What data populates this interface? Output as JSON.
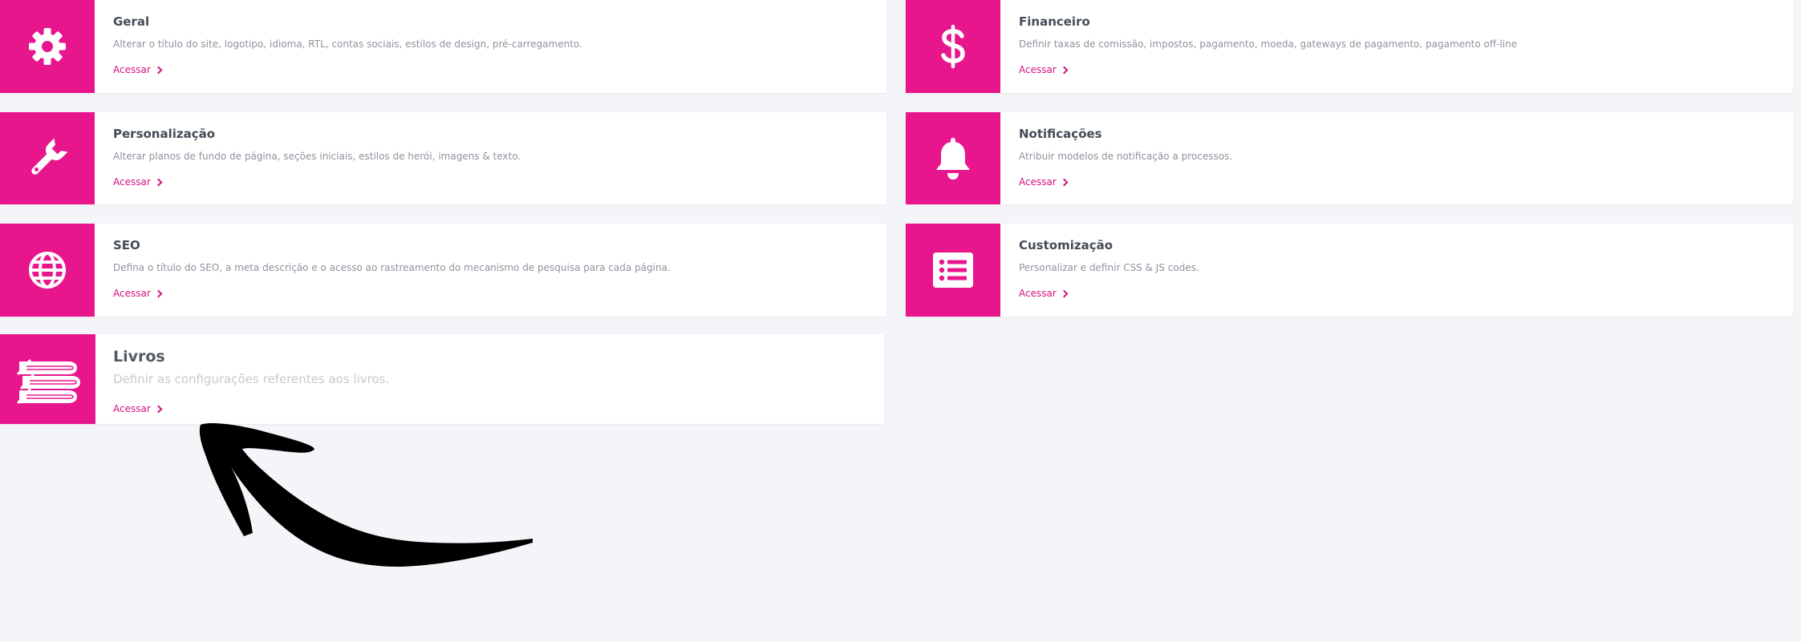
{
  "theme": {
    "accent": "#e8168c",
    "link": "#d4127f",
    "background": "#f4f5f9"
  },
  "cards": [
    {
      "title": "Geral",
      "description": "Alterar o título do site, logotipo, idioma, RTL, contas sociais, estilos de design, pré-carregamento.",
      "link": "Acessar",
      "icon": "gear-icon"
    },
    {
      "title": "Financeiro",
      "description": "Definir taxas de comissão, impostos, pagamento, moeda, gateways de pagamento, pagamento off-line",
      "link": "Acessar",
      "icon": "dollar-icon"
    },
    {
      "title": "Personalização",
      "description": "Alterar planos de fundo de página, seções iniciais, estilos de herói, imagens & texto.",
      "link": "Acessar",
      "icon": "wrench-icon"
    },
    {
      "title": "Notificações",
      "description": "Atribuir modelos de notificação a processos.",
      "link": "Acessar",
      "icon": "bell-icon"
    },
    {
      "title": "SEO",
      "description": "Defina o título do SEO, a meta descrição e o acesso ao rastreamento do mecanismo de pesquisa para cada página.",
      "link": "Acessar",
      "icon": "globe-icon"
    },
    {
      "title": "Customização",
      "description": "Personalizar e definir CSS & JS codes.",
      "link": "Acessar",
      "icon": "list-icon"
    },
    {
      "title": "Livros",
      "description": "Definir as configurações referentes aos livros.",
      "link": "Acessar",
      "icon": "books-icon"
    }
  ]
}
